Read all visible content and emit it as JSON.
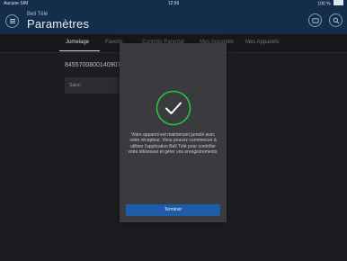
{
  "status_bar": {
    "carrier": "Aucune SIM",
    "time": "12:56",
    "battery": "100 %"
  },
  "header": {
    "app_name": "Bell Télé",
    "title": "Paramètres",
    "menu_icon": "hamburger-menu-icon",
    "device_icon": "tablet-icon",
    "search_icon": "search-icon"
  },
  "tabs": [
    {
      "label": "Jumelage",
      "active": true
    },
    {
      "label": "Favoris",
      "active": false
    },
    {
      "label": "Contrôle Parental",
      "active": false
    },
    {
      "label": "Mes Appareils",
      "active": false
    },
    {
      "label": "Mes Appareils",
      "active": false
    }
  ],
  "main": {
    "device_id": "8455700800140907",
    "room": "Salon"
  },
  "modal": {
    "icon": "checkmark-circle-icon",
    "message": "Votre appareil est maintenant jumelé avec votre récepteur. Vous pouvez commencer à utiliser l'application Bell Télé pour contrôler votre téléviseur et gérer vos enregistrements.",
    "done_button": "Terminer"
  },
  "colors": {
    "header_bg": "#142d4b",
    "modal_bg": "#3a3b3f",
    "accent_green": "#2fbf3b",
    "button_blue": "#1d5ca8"
  }
}
